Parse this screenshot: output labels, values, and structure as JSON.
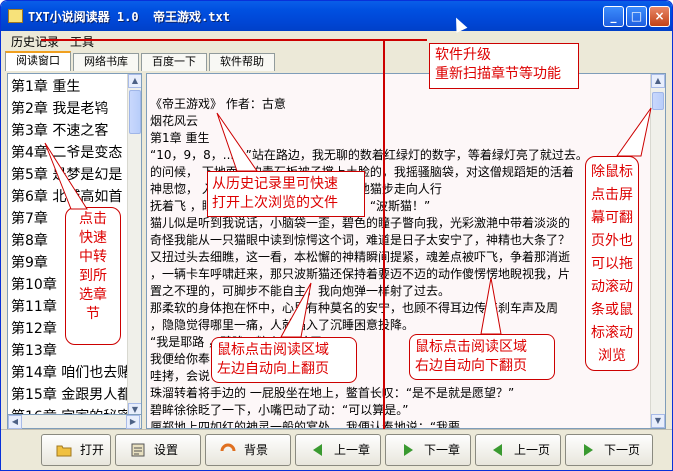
{
  "window": {
    "title": "TXT小说阅读器 1.0  帝王游戏.txt",
    "min_label": "_",
    "max_label": "□",
    "close_label": "×"
  },
  "menu": {
    "history": "历史记录",
    "tools": "工具"
  },
  "tabs": [
    "阅读窗口",
    "网络书库",
    "百度一下",
    "软件帮助"
  ],
  "chapters": [
    "第1章 重生",
    "第2章 我是老鸨",
    "第3章 不速之客",
    "第4章 二爷是变态",
    "第5章 是梦是幻是",
    "第6章 北城高如首",
    "第7章 ",
    "第8章 ",
    "第9章 ",
    "第10章 ",
    "第11章 ",
    "第12章 ",
    "第13章 ",
    "第14章 咱们也去赌",
    "第15章 金跟男人都",
    "第16章 宫家的秘密"
  ],
  "reader_lines": [
    "《帝王游戏》  作者：古意",
    "烟花风云",
    "第1章 重生",
    "“10，9，8，......”站在路边，我无聊的数着红绿灯的数字，等着绿灯亮了就过去。",
    "的问候，    下地面上的青石板被子撑上土脸的，我摇骚脑袋，对这僧规蹈矩的活着",
    "神思惚，                     入一只白色的身影，迈着优雅地猫步走向人行",
    "抚着飞    ，眼神清澈的大猫，我心里一喊：“波斯猫！”",
    "猫儿似是听到我说话，小脑袋一歪，碧色的瞳子瞥向我，光彩激滟中带着淡淡的",
    "奇怪我能从一只猫眼中读到惊愕这个词，难道是日子太安宁了，神精也大条了？",
    "又扭过头去细瞧，这一看，本松懈的神精瞬间提紧，魂差点被吓飞，争着那消逝",
    "，一辆卡车呼啸赶来，那只波斯猫还保持着要迈不迈的动作傻愣愣地睨视我，片",
    "置之不理的，可脚步不能自主，我向炮弹一样射了过去。",
    "那柔软的身体抱在怀中，心里有种莫名的安宁，也顾不得耳边传来刹车声及周",
    "，隐隐觉得哪里一痛，人就陷入了沉睡困意投降。",
    "“我是耶路        ，碧眸一粒火：“给了",
    "我便给你奉        ",
    "哇拷，会说        说什么来        ，我眼",
    "珠溜转着将手边的            一屁股坐在地上，鳖首长叹：“是不是就是愿望？”",
    "碧眸徐徐眨了一下，小嘴巴动了动：“可以算是。”",
    "厘郑地上四如红的神灵一般的宴处，         我便认奉地说：“我要"
  ],
  "toolbar": [
    {
      "label": "打开",
      "icon": "folder-icon"
    },
    {
      "label": "设置",
      "icon": "settings-icon"
    },
    {
      "label": "背景",
      "icon": "background-icon"
    },
    {
      "label": "上一章",
      "icon": "prev-chapter-icon"
    },
    {
      "label": "下一章",
      "icon": "next-chapter-icon"
    },
    {
      "label": "上一页",
      "icon": "prev-page-icon"
    },
    {
      "label": "下一页",
      "icon": "next-page-icon"
    }
  ],
  "callouts": {
    "upgrade": "软件升级\n重新扫描章节等功能",
    "history": "从历史记录里可快速\n打开上次浏览的文件",
    "chapters": "点击\n快速\n中转\n到所\n选章\n节",
    "scroll": "除鼠标\n点击屏\n幕可翻\n页外也\n可以拖\n动滚动\n条或鼠\n标滚动\n浏览",
    "page_up": "鼠标点击阅读区域\n左边自动向上翻页",
    "page_down": "鼠标点击阅读区域\n右边自动向下翻页"
  },
  "colors": {
    "annotation": "#cc0000",
    "titlebar": "#0050e0",
    "reader_bg": "#fdf7f8"
  }
}
